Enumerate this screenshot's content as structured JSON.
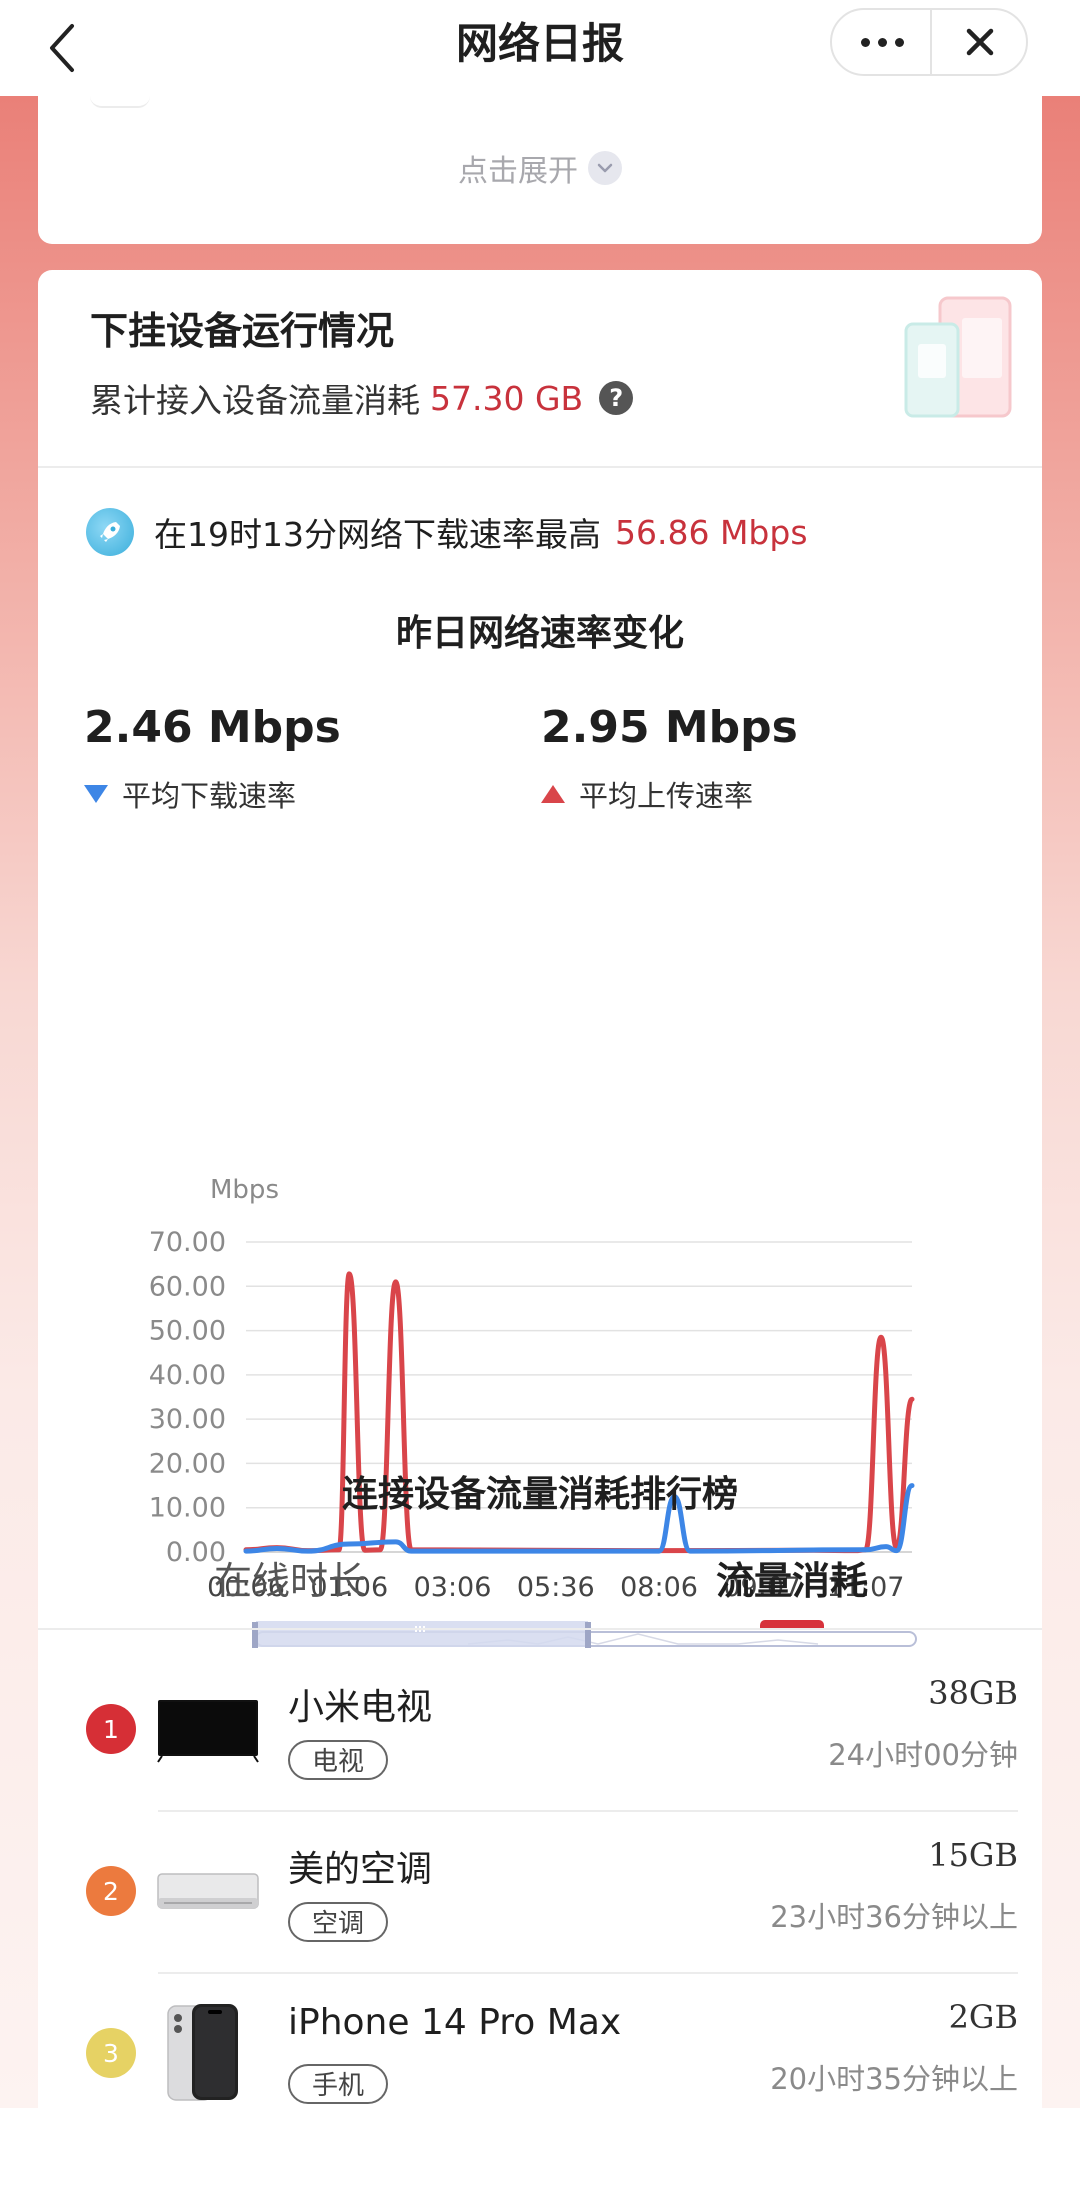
{
  "nav": {
    "title": "网络日报"
  },
  "expand": {
    "label": "点击展开"
  },
  "device_section": {
    "title": "下挂设备运行情况",
    "accum_label": "累计接入设备流量消耗",
    "accum_value": "57.30 GB",
    "help": "?"
  },
  "peak": {
    "text": "在19时13分网络下载速率最高",
    "value": "56.86 Mbps"
  },
  "speed_chart": {
    "title": "昨日网络速率变化",
    "avg_download_value": "2.46 Mbps",
    "avg_download_label": "平均下载速率",
    "avg_upload_value": "2.95 Mbps",
    "avg_upload_label": "平均上传速率",
    "colors": {
      "download": "#3d86e6",
      "upload": "#d9454a"
    }
  },
  "chart_data": {
    "type": "line",
    "ylabel": "Mbps",
    "ylim": [
      0,
      70
    ],
    "yticks": [
      "70.00",
      "60.00",
      "50.00",
      "40.00",
      "30.00",
      "20.00",
      "10.00",
      "0.00"
    ],
    "xticks": [
      "00:06",
      "01:06",
      "03:06",
      "05:36",
      "08:06",
      "09:07",
      "11:07"
    ],
    "grid": true,
    "series": [
      {
        "key": "upload",
        "points": [
          [
            0,
            0.5
          ],
          [
            0.3,
            1
          ],
          [
            0.6,
            0.3
          ],
          [
            0.9,
            0.5
          ],
          [
            1,
            62.8
          ],
          [
            1.15,
            0.4
          ],
          [
            1.3,
            0.5
          ],
          [
            1.45,
            61
          ],
          [
            1.6,
            0.5
          ],
          [
            4,
            0.3
          ],
          [
            5.5,
            0.4
          ],
          [
            5.9,
            0.3
          ],
          [
            6.0,
            0.5
          ],
          [
            6.15,
            48.5
          ],
          [
            6.3,
            1
          ],
          [
            6.45,
            34.5
          ]
        ]
      },
      {
        "key": "download",
        "points": [
          [
            0,
            0.2
          ],
          [
            0.3,
            0.8
          ],
          [
            0.6,
            0.2
          ],
          [
            1,
            1.8
          ],
          [
            1.45,
            2.3
          ],
          [
            1.6,
            0.2
          ],
          [
            4,
            0.2
          ],
          [
            4.15,
            12.5
          ],
          [
            4.3,
            0.2
          ],
          [
            6,
            0.5
          ],
          [
            6.2,
            1.2
          ],
          [
            6.3,
            0.3
          ],
          [
            6.45,
            15
          ]
        ]
      }
    ]
  },
  "ranking": {
    "title": "连接设备流量消耗排行榜",
    "tab_online": "在线时长",
    "tab_traffic": "流量消耗",
    "rows": [
      {
        "rank": "1",
        "name": "小米电视",
        "tag": "电视",
        "usage": "38GB",
        "duration": "24小时00分钟",
        "badge_color": "#d62f36"
      },
      {
        "rank": "2",
        "name": "美的空调",
        "tag": "空调",
        "usage": "15GB",
        "duration": "23小时36分钟以上",
        "badge_color": "#ec7a3e"
      },
      {
        "rank": "3",
        "name": "iPhone 14 Pro Max",
        "tag": "手机",
        "usage": "2GB",
        "duration": "20小时35分钟以上",
        "badge_color": "#e6d264"
      }
    ]
  }
}
